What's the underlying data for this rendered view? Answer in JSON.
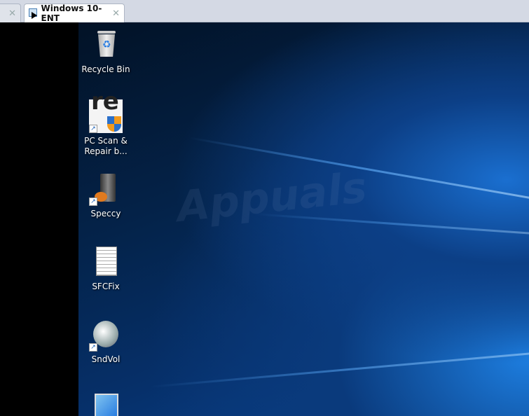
{
  "tabs": [
    {
      "label": "",
      "active": false
    },
    {
      "label": "Windows 10-ENT",
      "active": true
    }
  ],
  "close_glyph": "✕",
  "watermark": "Appuals",
  "desktop_icons": [
    {
      "label": "Recycle Bin",
      "icon": "recycle-bin-icon"
    },
    {
      "label": "PC Scan & Repair b...",
      "icon": "pc-scan-repair-icon",
      "glyph_text": "re"
    },
    {
      "label": "Speccy",
      "icon": "speccy-icon"
    },
    {
      "label": "SFCFix",
      "icon": "text-file-icon"
    },
    {
      "label": "SndVol",
      "icon": "speaker-icon"
    },
    {
      "label": "",
      "icon": "installer-icon"
    }
  ]
}
